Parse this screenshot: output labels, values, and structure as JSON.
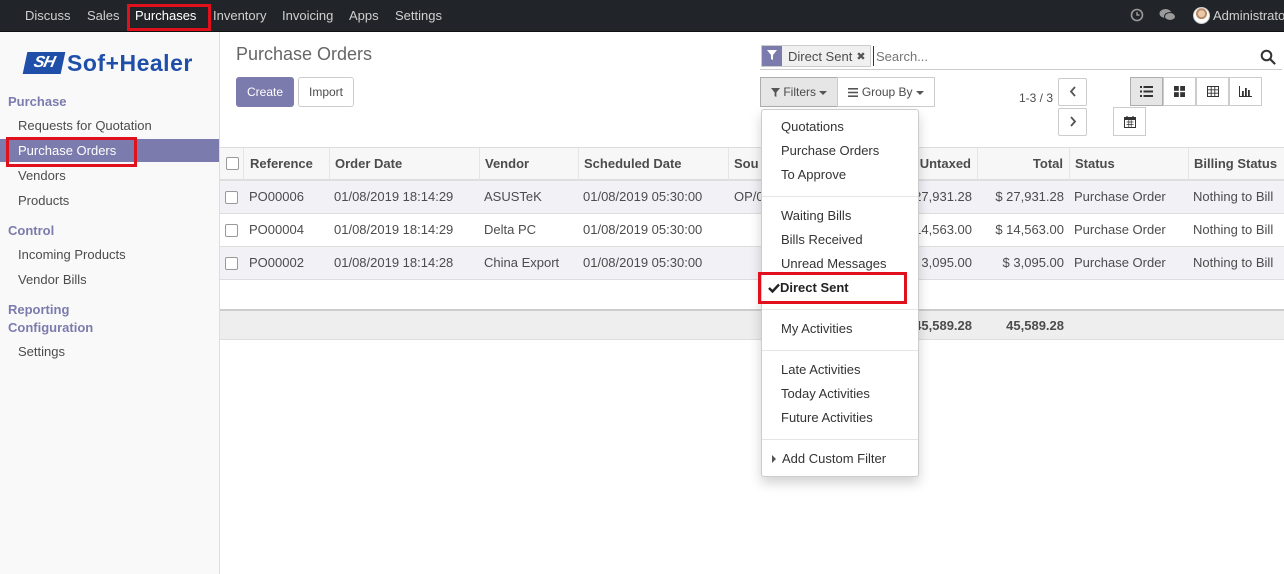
{
  "topbar": {
    "menus": [
      "Discuss",
      "Sales",
      "Purchases",
      "Inventory",
      "Invoicing",
      "Apps",
      "Settings"
    ],
    "active_menu": "Purchases",
    "user_name": "Administrator"
  },
  "sidebar": {
    "logo_text": "Sof+Healer",
    "logo_mark": "SH",
    "sections": [
      {
        "heading": "Purchase",
        "items": [
          "Requests for Quotation",
          "Purchase Orders",
          "Vendors",
          "Products"
        ]
      },
      {
        "heading": "Control",
        "items": [
          "Incoming Products",
          "Vendor Bills"
        ]
      },
      {
        "heading": "Reporting",
        "items": []
      },
      {
        "heading": "Configuration",
        "items": [
          "Settings"
        ]
      }
    ],
    "active_item": "Purchase Orders"
  },
  "control_panel": {
    "title": "Purchase Orders",
    "create_label": "Create",
    "import_label": "Import",
    "search": {
      "facet_label": "Direct Sent",
      "placeholder": "Search..."
    },
    "filters_label": "Filters",
    "group_by_label": "Group By",
    "pager_value": "1-3 / 3"
  },
  "table": {
    "columns": [
      "Reference",
      "Order Date",
      "Vendor",
      "Scheduled Date",
      "Sou",
      "Untaxed",
      "Total",
      "Status",
      "Billing Status"
    ],
    "rows": [
      {
        "reference": "PO00006",
        "order_date": "01/08/2019 18:14:29",
        "vendor": "ASUSTeK",
        "scheduled_date": "01/08/2019 05:30:00",
        "source": "OP/0",
        "untaxed": "27,931.28",
        "total": "$ 27,931.28",
        "status": "Purchase Order",
        "billing_status": "Nothing to Bill"
      },
      {
        "reference": "PO00004",
        "order_date": "01/08/2019 18:14:29",
        "vendor": "Delta PC",
        "scheduled_date": "01/08/2019 05:30:00",
        "source": "",
        "untaxed": "14,563.00",
        "total": "$ 14,563.00",
        "status": "Purchase Order",
        "billing_status": "Nothing to Bill"
      },
      {
        "reference": "PO00002",
        "order_date": "01/08/2019 18:14:28",
        "vendor": "China Export",
        "scheduled_date": "01/08/2019 05:30:00",
        "source": "",
        "untaxed": "3,095.00",
        "total": "$ 3,095.00",
        "status": "Purchase Order",
        "billing_status": "Nothing to Bill"
      }
    ],
    "totals": {
      "untaxed": "45,589.28",
      "total": "45,589.28"
    }
  },
  "filters_menu": {
    "groups": [
      [
        "Quotations",
        "Purchase Orders",
        "To Approve"
      ],
      [
        "Waiting Bills",
        "Bills Received",
        "Unread Messages",
        "Direct Sent"
      ],
      [
        "My Activities"
      ],
      [
        "Late Activities",
        "Today Activities",
        "Future Activities"
      ],
      [
        "Add Custom Filter"
      ]
    ],
    "checked": "Direct Sent"
  },
  "colors": {
    "brand": "#7c7bad",
    "topbar": "#212529",
    "highlight": "#e0101c",
    "logo": "#1f4fa8"
  }
}
